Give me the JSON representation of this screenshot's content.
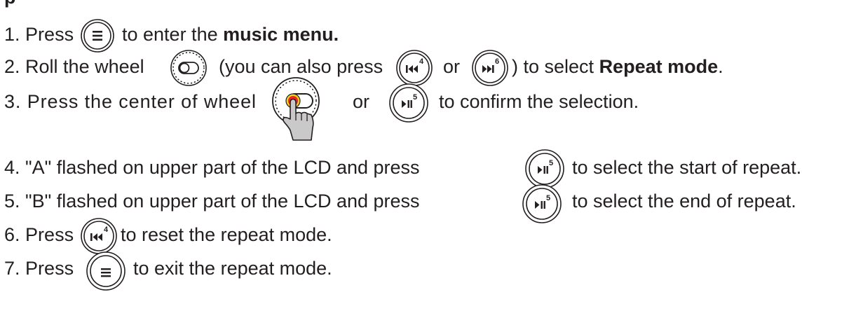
{
  "heading_fragment": "p",
  "steps": [
    {
      "num": "1.",
      "pre": "Press",
      "post": "to enter the",
      "bold": "music menu."
    },
    {
      "num": "2.",
      "pre": "Roll the wheel",
      "mid1": "(you can also press",
      "mid2": "or",
      "post": ") to select",
      "bold": "Repeat mode",
      "end": "."
    },
    {
      "num": "3.",
      "pre": "Press the center of wheel",
      "mid": "or",
      "post": "to confirm the selection."
    },
    {
      "num": "4.",
      "pre": "\"A\" flashed on upper part of the LCD and press",
      "post": "to select the start of repeat."
    },
    {
      "num": "5.",
      "pre": "\"B\" flashed on upper part of the LCD and press",
      "post": "to select the end of repeat."
    },
    {
      "num": "6.",
      "pre": "Press",
      "post": "to reset the repeat mode."
    },
    {
      "num": "7.",
      "pre": "Press",
      "post": "to exit the repeat mode."
    }
  ],
  "icons": {
    "menu": "menu-icon",
    "prev": "previous-track-icon",
    "next": "next-track-icon",
    "play": "play-pause-icon",
    "wheel": "scroll-wheel-icon",
    "hand": "pointing-hand-icon"
  },
  "key_numbers": {
    "prev": "4",
    "next": "6",
    "play": "5"
  },
  "colors": {
    "text": "#231f20",
    "press_red": "#e8262a",
    "press_yellow": "#f7d117",
    "hand_fill": "#c9c9c9"
  }
}
